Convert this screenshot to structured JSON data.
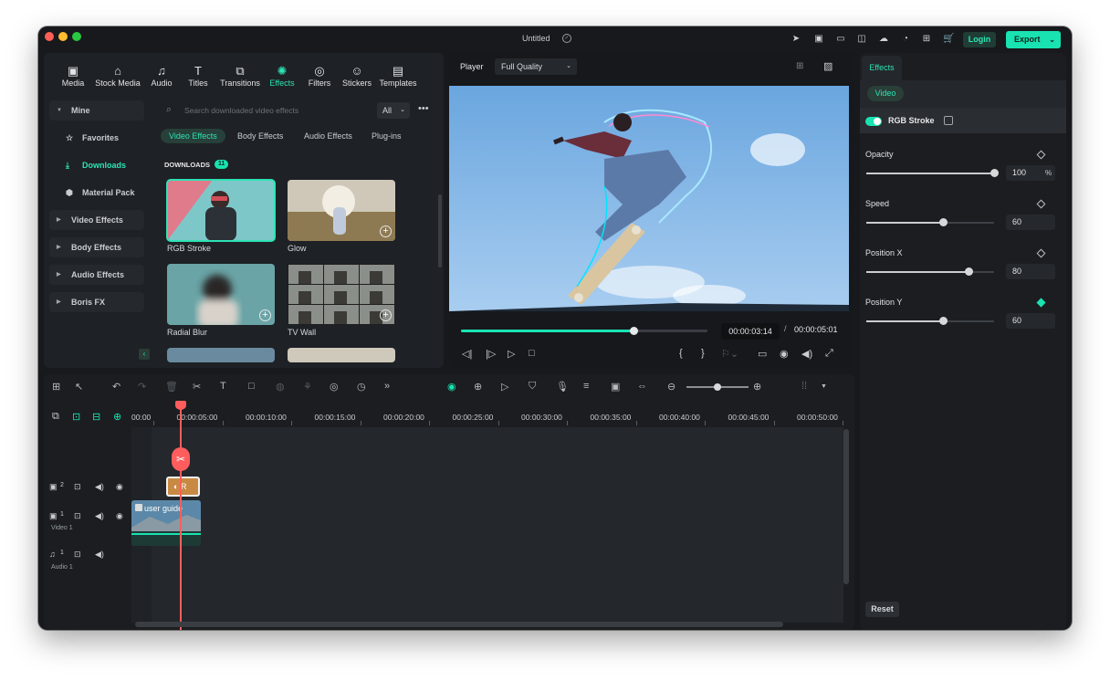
{
  "window": {
    "title": "Untitled",
    "login": "Login",
    "export": "Export"
  },
  "library": {
    "tabs": [
      {
        "label": "Media",
        "icon": "media-icon"
      },
      {
        "label": "Stock Media",
        "icon": "stock-media-icon"
      },
      {
        "label": "Audio",
        "icon": "audio-icon"
      },
      {
        "label": "Titles",
        "icon": "titles-icon"
      },
      {
        "label": "Transitions",
        "icon": "transitions-icon"
      },
      {
        "label": "Effects",
        "icon": "effects-icon"
      },
      {
        "label": "Filters",
        "icon": "filters-icon"
      },
      {
        "label": "Stickers",
        "icon": "stickers-icon"
      },
      {
        "label": "Templates",
        "icon": "templates-icon"
      }
    ],
    "active_tab": "Effects",
    "sidebar": {
      "mine": "Mine",
      "favorites": "Favorites",
      "downloads": "Downloads",
      "material_pack": "Material Pack",
      "video_effects": "Video Effects",
      "body_effects": "Body Effects",
      "audio_effects": "Audio Effects",
      "boris_fx": "Boris FX"
    },
    "search_placeholder": "Search downloaded video effects",
    "filter": "All",
    "categories": [
      "Video Effects",
      "Body Effects",
      "Audio Effects",
      "Plug-ins"
    ],
    "downloads_header": "DOWNLOADS",
    "downloads_count": "11",
    "items": [
      "RGB Stroke",
      "Glow",
      "Radial Blur",
      "TV Wall"
    ]
  },
  "player": {
    "label": "Player",
    "quality": "Full Quality",
    "current_time": "00:00:03:14",
    "separator": "/",
    "total_time": "00:00:05:01",
    "progress": 0.7
  },
  "timeline": {
    "ruler": [
      "00:00",
      "00:00:05:00",
      "00:00:10:00",
      "00:00:15:00",
      "00:00:20:00",
      "00:00:25:00",
      "00:00:30:00",
      "00:00:35:00",
      "00:00:40:00",
      "00:00:45:00",
      "00:00:50:00"
    ],
    "tracks": {
      "fx_num": "2",
      "video_num": "1",
      "video_name": "Video 1",
      "audio_num": "1",
      "audio_name": "Audio 1"
    },
    "fx_clip_label": "R",
    "video_clip_label": "user guide"
  },
  "properties": {
    "tab": "Effects",
    "video": "Video",
    "effect_name": "RGB Stroke",
    "opacity": {
      "label": "Opacity",
      "value": "100",
      "unit": "%",
      "level": 1.0
    },
    "speed": {
      "label": "Speed",
      "value": "60",
      "level": 0.6
    },
    "position_x": {
      "label": "Position X",
      "value": "80",
      "level": 0.8
    },
    "position_y": {
      "label": "Position Y",
      "value": "60",
      "level": 0.6
    },
    "reset": "Reset"
  },
  "colors": {
    "accent": "#19e3b1",
    "playhead": "#ff5d5d",
    "bg": "#17191c"
  }
}
